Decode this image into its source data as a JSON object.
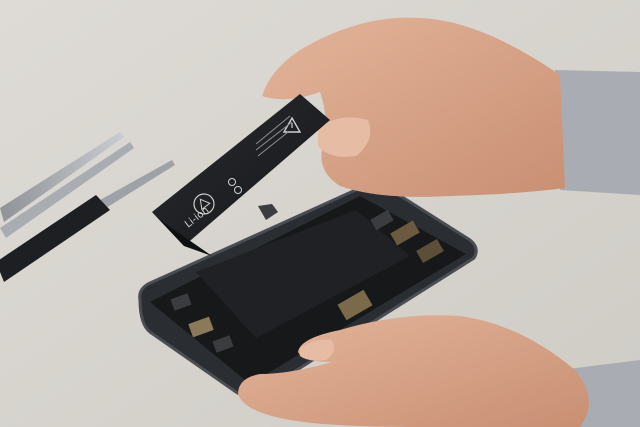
{
  "scene": {
    "background_color": "#d9d6d1",
    "skin_color": "#d9a58a",
    "sleeve_color": "#a9adb3",
    "phone_color": "#1c1e21"
  },
  "battery": {
    "brand_text": "Li-ion",
    "warning_icon": "warning-triangle-icon",
    "recycle_icon": "recycle-icon"
  },
  "tools": [
    {
      "name": "tweezers"
    },
    {
      "name": "spudger"
    }
  ]
}
